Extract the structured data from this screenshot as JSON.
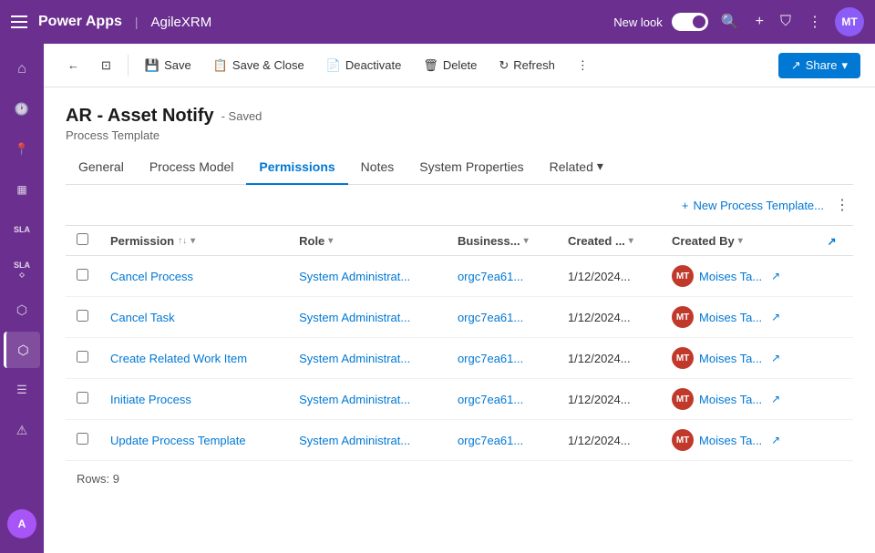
{
  "topNav": {
    "appTitle": "Power Apps",
    "divider": "|",
    "appName": "AgileXRM",
    "newLookLabel": "New look",
    "avatarLabel": "MT"
  },
  "toolbar": {
    "backLabel": "←",
    "expandLabel": "⊡",
    "saveLabel": "Save",
    "saveCloseLabel": "Save & Close",
    "deactivateLabel": "Deactivate",
    "deleteLabel": "Delete",
    "refreshLabel": "Refresh",
    "moreLabel": "⋮",
    "shareLabel": "Share",
    "shareArrow": "▾"
  },
  "page": {
    "title": "AR - Asset Notify",
    "savedBadge": "- Saved",
    "subtitle": "Process Template"
  },
  "tabs": [
    {
      "id": "general",
      "label": "General"
    },
    {
      "id": "process-model",
      "label": "Process Model"
    },
    {
      "id": "permissions",
      "label": "Permissions",
      "active": true
    },
    {
      "id": "notes",
      "label": "Notes"
    },
    {
      "id": "system-properties",
      "label": "System Properties"
    },
    {
      "id": "related",
      "label": "Related",
      "hasArrow": true
    }
  ],
  "tableToolbar": {
    "newTemplateLabel": "New Process Template...",
    "plusIcon": "+"
  },
  "tableHeaders": [
    {
      "id": "permission",
      "label": "Permission",
      "sortable": true,
      "filterable": true
    },
    {
      "id": "role",
      "label": "Role",
      "filterable": true
    },
    {
      "id": "business-unit",
      "label": "Business...",
      "filterable": true
    },
    {
      "id": "created",
      "label": "Created ...",
      "filterable": true
    },
    {
      "id": "created-by",
      "label": "Created By",
      "filterable": true
    },
    {
      "id": "external",
      "label": ""
    }
  ],
  "tableRows": [
    {
      "id": 1,
      "permission": "Cancel Process",
      "role": "System Administrat...",
      "businessUnit": "orgc7ea61...",
      "created": "1/12/2024...",
      "createdBy": "Moises Ta...",
      "avatarLabel": "MT"
    },
    {
      "id": 2,
      "permission": "Cancel Task",
      "role": "System Administrat...",
      "businessUnit": "orgc7ea61...",
      "created": "1/12/2024...",
      "createdBy": "Moises Ta...",
      "avatarLabel": "MT"
    },
    {
      "id": 3,
      "permission": "Create Related Work Item",
      "role": "System Administrat...",
      "businessUnit": "orgc7ea61...",
      "created": "1/12/2024...",
      "createdBy": "Moises Ta...",
      "avatarLabel": "MT"
    },
    {
      "id": 4,
      "permission": "Initiate Process",
      "role": "System Administrat...",
      "businessUnit": "orgc7ea61...",
      "created": "1/12/2024...",
      "createdBy": "Moises Ta...",
      "avatarLabel": "MT"
    },
    {
      "id": 5,
      "permission": "Update Process Template",
      "role": "System Administrat...",
      "businessUnit": "orgc7ea61...",
      "created": "1/12/2024...",
      "createdBy": "Moises Ta...",
      "avatarLabel": "MT"
    }
  ],
  "rowsCount": "Rows: 9",
  "sidebarItems": [
    {
      "id": "home",
      "icon": "⌂",
      "label": "Home"
    },
    {
      "id": "recent",
      "icon": "🕐",
      "label": "Recent"
    },
    {
      "id": "pinned",
      "icon": "📌",
      "label": "Pinned"
    },
    {
      "id": "dashboard",
      "icon": "▦",
      "label": "Dashboard"
    },
    {
      "id": "sla1",
      "icon": "SLA",
      "label": "SLA"
    },
    {
      "id": "sla2",
      "icon": "SLA",
      "label": "SLA Alt"
    },
    {
      "id": "network",
      "icon": "⬡",
      "label": "Network"
    },
    {
      "id": "active",
      "icon": "⬡",
      "label": "Active",
      "active": true
    },
    {
      "id": "list",
      "icon": "☰",
      "label": "List"
    },
    {
      "id": "alert",
      "icon": "⚠",
      "label": "Alert"
    }
  ]
}
